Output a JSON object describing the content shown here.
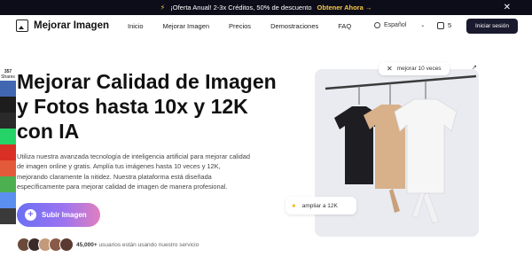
{
  "promo": {
    "text": "¡Oferta Anual! 2-3x Créditos, 50% de descuento",
    "cta": "Obtener Ahora →"
  },
  "header": {
    "logo": "Mejorar Imagen",
    "nav": [
      "Inicio",
      "Mejorar Imagen",
      "Precios",
      "Demostraciones",
      "FAQ"
    ],
    "language": "Español",
    "credits": "5",
    "login": "Iniciar sesión"
  },
  "share": {
    "count": "357",
    "count_label": "Shares",
    "colors": [
      "#4267b2",
      "#1d1d1d",
      "#2a2a2a",
      "#25d366",
      "#d93025",
      "#e35a3a",
      "#4caf50",
      "#5b8ff0",
      "#3a3a3a"
    ]
  },
  "hero": {
    "title": "Mejorar Calidad de Imagen y Fotos hasta 10x y 12K con IA",
    "description": "Utiliza nuestra avanzada tecnología de inteligencia artificial para mejorar calidad de imagen online y gratis. Amplía tus imágenes hasta 10 veces y 12K, mejorando claramente la nitidez. Nuestra plataforma está diseñada específicamente para mejorar calidad de imagen de manera profesional.",
    "upload": "Subir Imagen",
    "users_count": "45,000+",
    "users_text": "usuarios están usando nuestro servicio"
  },
  "card": {
    "badge_top": "mejorar 10 veces",
    "badge_bottom": "ampliar a 12K"
  }
}
